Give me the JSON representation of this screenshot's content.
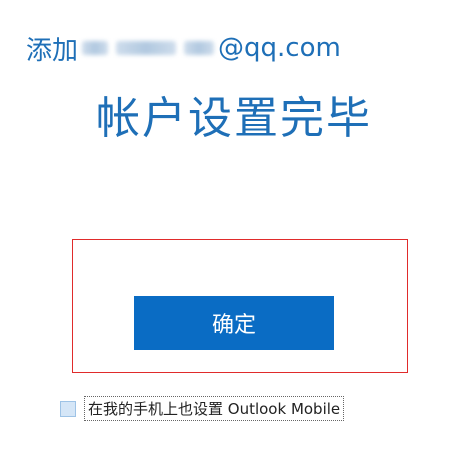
{
  "header": {
    "add_prefix": "添加",
    "email_suffix": "@qq.com",
    "title": "帐户设置完毕"
  },
  "actions": {
    "ok_label": "确定"
  },
  "options": {
    "mobile_label": "在我的手机上也设置 Outlook Mobile",
    "mobile_checked": false
  },
  "colors": {
    "accent": "#1e6fb7",
    "button": "#0a6cc4",
    "highlight_border": "#e02b2b"
  }
}
